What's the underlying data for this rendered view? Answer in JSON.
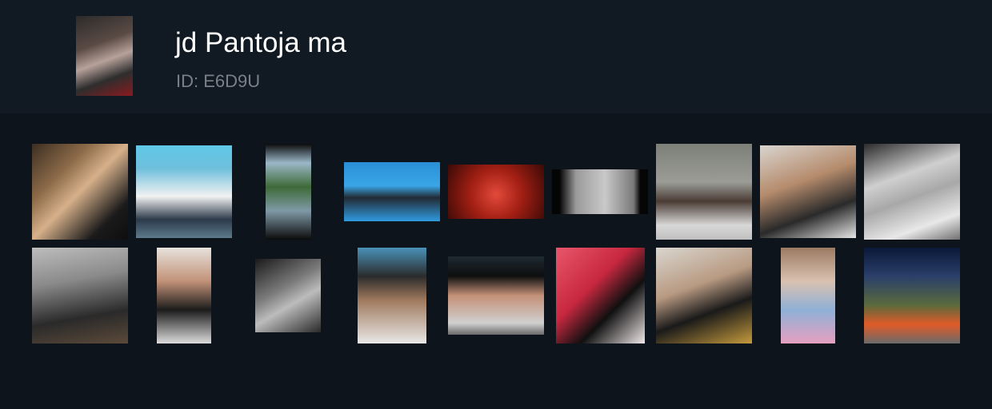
{
  "profile": {
    "name": "jd Pantoja ma",
    "id_text": "ID: E6D9U",
    "avatar_desc": "profile-photo"
  },
  "gallery": {
    "photo_count": 18
  }
}
